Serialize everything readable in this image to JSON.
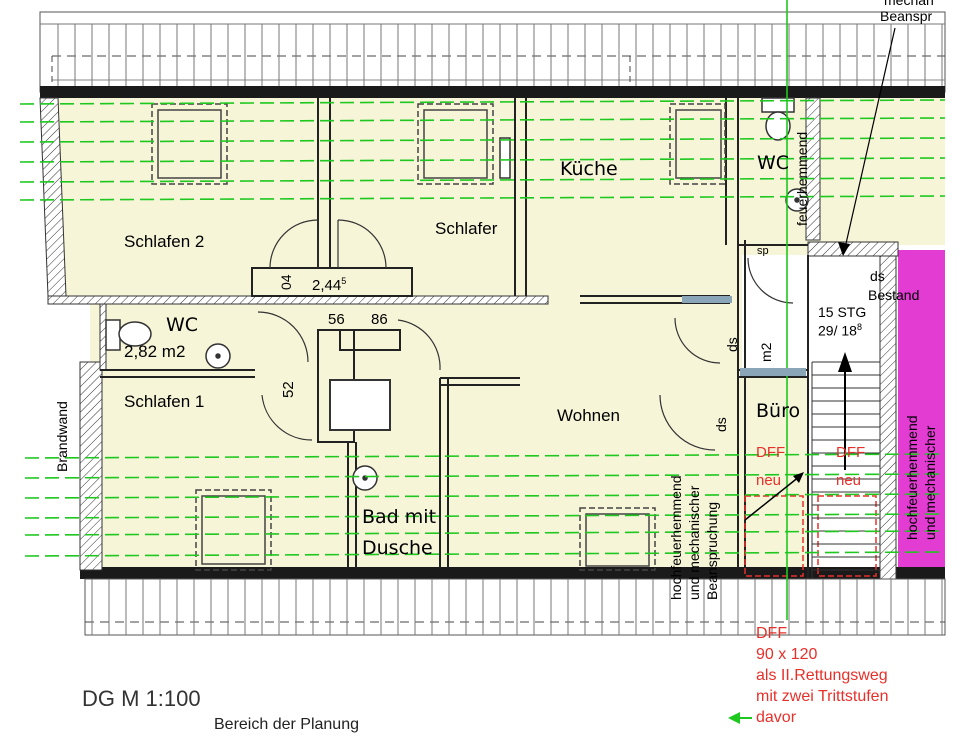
{
  "title": "DG M 1:100",
  "subtitle": "Bereich der Planung",
  "rooms": {
    "schlafen2": "Schlafen 2",
    "schlafer": "Schlafer",
    "kueche": "Küche",
    "wc_top": "WC",
    "wc_left": "WC",
    "wc_area": "2,82 m2",
    "schlafen1": "Schlafen 1",
    "wohnen": "Wohnen",
    "bad": "Bad mit",
    "bad2": "Dusche",
    "buero": "Büro"
  },
  "dimensions": {
    "d_244": "2,44",
    "d_244_sup": "5",
    "d_04": "04",
    "d_56": "56",
    "d_86": "86",
    "d_52": "52",
    "stairs": "15 STG",
    "stairs_ratio": "29/ 18",
    "stairs_sup": "8",
    "ds": "ds",
    "m2": "m2"
  },
  "labels": {
    "brandwand": "Brandwand",
    "feuerhemmend": "feuerhemmend",
    "ds_bestand": "ds",
    "bestand": "Bestand",
    "hfm1": "hochfeuerhemmend",
    "hfm2": "und mechanischer",
    "hfm3": "Beanspruchung",
    "hfr1": "hochfeuerhemmend",
    "hfr2": "und mechanischer",
    "mechan_top": "mechan",
    "beanspr_top": "Beanspr",
    "dff_left": "DFF",
    "neu_left": "neu",
    "dff_right": "DFF",
    "neu_right": "neu"
  },
  "note": {
    "l1": "DFF",
    "l2": "90 x 120",
    "l3": "als II.Rettungsweg",
    "l4": "mit zwei Trittstufen",
    "l5": "davor"
  },
  "colors": {
    "room_fill": "#f6f5d8",
    "existing_fill": "#e23cd3",
    "green_line": "#1ec81e",
    "red_text": "#e8302a",
    "wall": "#1a1a1a"
  }
}
